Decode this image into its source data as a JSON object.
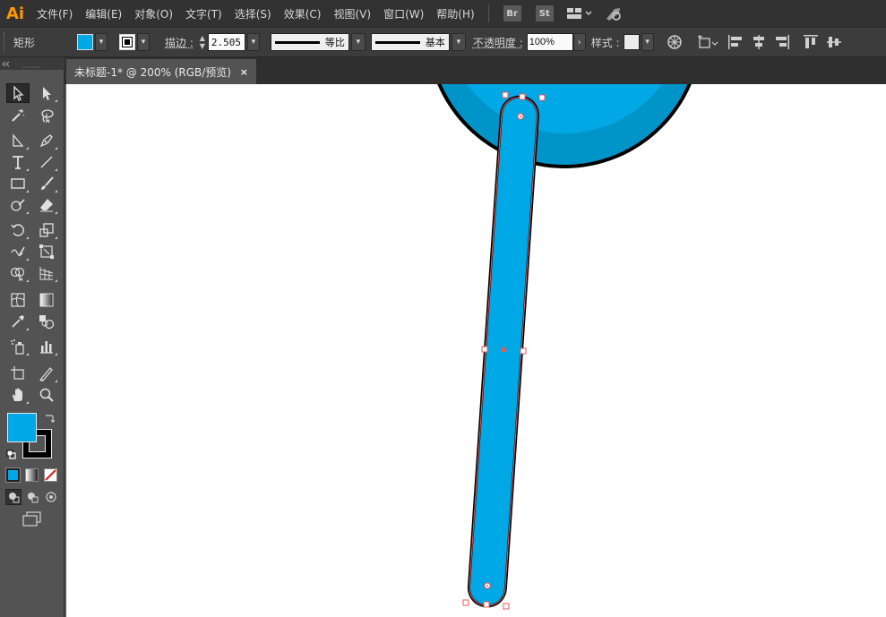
{
  "app": {
    "logo": "Ai"
  },
  "menu": [
    {
      "name": "menu-file",
      "label": "文件(F)"
    },
    {
      "name": "menu-edit",
      "label": "编辑(E)"
    },
    {
      "name": "menu-object",
      "label": "对象(O)"
    },
    {
      "name": "menu-type",
      "label": "文字(T)"
    },
    {
      "name": "menu-select",
      "label": "选择(S)"
    },
    {
      "name": "menu-effect",
      "label": "效果(C)"
    },
    {
      "name": "menu-view",
      "label": "视图(V)"
    },
    {
      "name": "menu-window",
      "label": "窗口(W)"
    },
    {
      "name": "menu-help",
      "label": "帮助(H)"
    }
  ],
  "app_badges": {
    "bridge": "Br",
    "stock": "St"
  },
  "control": {
    "object_type": "矩形",
    "stroke_label": "描边 :",
    "stroke_width": "2.505",
    "profile_label": "等比",
    "brush_label": "基本",
    "opacity_label": "不透明度 :",
    "opacity_value": "100%",
    "style_label": "样式 :"
  },
  "document_tab": {
    "title": "未标题-1* @ 200% (RGB/预览)",
    "close": "×"
  },
  "colors": {
    "fill": "#00a8e6",
    "fill_dark": "#0094c8",
    "stroke": "#000000",
    "selection": "#e85a5a",
    "accent": "#ff9a00"
  },
  "icons": [
    "selection-tool-icon",
    "direct-selection-tool-icon",
    "magic-wand-tool-icon",
    "lasso-tool-icon",
    "pen-tool-icon",
    "curvature-tool-icon",
    "type-tool-icon",
    "line-segment-tool-icon",
    "rectangle-tool-icon",
    "paintbrush-tool-icon",
    "shaper-tool-icon",
    "eraser-tool-icon",
    "rotate-tool-icon",
    "scale-tool-icon",
    "warp-tool-icon",
    "free-transform-tool-icon",
    "shape-builder-tool-icon",
    "perspective-grid-tool-icon",
    "mesh-tool-icon",
    "gradient-tool-icon",
    "eyedropper-tool-icon",
    "blend-tool-icon",
    "symbol-sprayer-tool-icon",
    "column-graph-tool-icon",
    "artboard-tool-icon",
    "slice-tool-icon",
    "hand-tool-icon",
    "zoom-tool-icon"
  ]
}
